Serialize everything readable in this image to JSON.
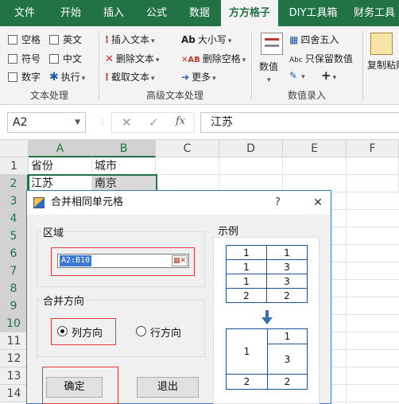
{
  "ribbon": {
    "tabs": [
      "文件",
      "开始",
      "插入",
      "公式",
      "数据",
      "方方格子",
      "DIY工具箱",
      "财务工具"
    ],
    "active_tab": "方方格子",
    "text_processing": {
      "checkboxes": [
        "空格",
        "英文",
        "符号",
        "中文",
        "数字"
      ],
      "execute_label": "执行",
      "group_label": "文本处理"
    },
    "advanced_text": {
      "insert_text": "插入文本",
      "delete_text": "删除文本",
      "extract_text": "截取文本",
      "case_label": "大小写",
      "delete_spaces": "删除空格",
      "more": "更多",
      "group_label": "高级文本处理"
    },
    "numeric_entry": {
      "value_label": "数值",
      "round_half": "四舍五入",
      "keep_value": "只保留数值",
      "ab_prefix": "Abc",
      "plus": "+",
      "group_label": "数值录入"
    },
    "paste": {
      "label": "复制粘贴"
    }
  },
  "formula_bar": {
    "name_box": "A2",
    "cancel_icon": "✕",
    "confirm_icon": "✓",
    "fx": "fx",
    "content": "江苏"
  },
  "sheet": {
    "columns": [
      "A",
      "B",
      "C",
      "D",
      "E",
      "F"
    ],
    "rows": [
      "1",
      "2",
      "3",
      "4",
      "5",
      "6",
      "7",
      "8",
      "9",
      "10",
      "11",
      "12",
      "13",
      "14"
    ],
    "cells": {
      "A1": "省份",
      "B1": "城市",
      "A2": "江苏",
      "B2": "南京"
    }
  },
  "dialog": {
    "title": "合并相同单元格",
    "help": "?",
    "close": "✕",
    "region_label": "区域",
    "range_value": "A2:B10",
    "direction_label": "合并方向",
    "col_direction": "列方向",
    "row_direction": "行方向",
    "selected_direction": "列方向",
    "example_label": "示例",
    "ok_label": "确定",
    "exit_label": "退出",
    "example_before": [
      [
        "1",
        "1"
      ],
      [
        "1",
        "3"
      ],
      [
        "1",
        "3"
      ],
      [
        "2",
        "2"
      ]
    ],
    "example_after": {
      "merged_left": "1",
      "right_top": "1",
      "right_mid": "3",
      "bottom_left": "2",
      "bottom_right": "2"
    }
  },
  "colors": {
    "ribbon_green": "#217346",
    "dialog_border": "#3c78c3",
    "highlight_red": "#e23b3b",
    "diagram_blue": "#1f4e9a"
  }
}
